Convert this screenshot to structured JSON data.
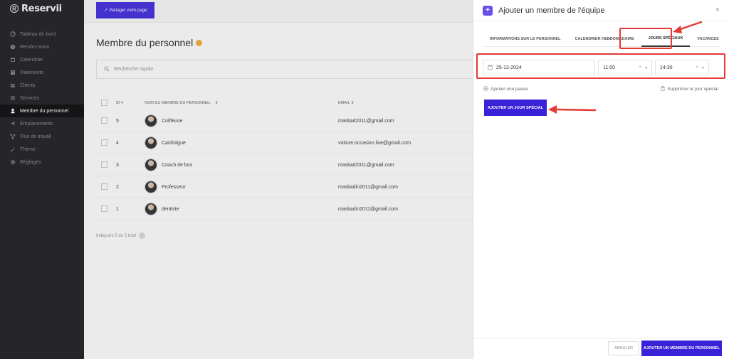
{
  "brand": {
    "name": "Reservii",
    "logo_letter": "R"
  },
  "sidebar": {
    "items": [
      {
        "label": "Tableau de bord",
        "icon": "dashboard-icon"
      },
      {
        "label": "Rendez-vous",
        "icon": "clock-icon"
      },
      {
        "label": "Calendrier",
        "icon": "calendar-icon"
      },
      {
        "label": "Paiements",
        "icon": "payment-icon"
      },
      {
        "label": "Clients",
        "icon": "users-icon"
      },
      {
        "label": "Services",
        "icon": "list-icon"
      },
      {
        "label": "Membre du personnel",
        "icon": "person-icon",
        "active": true
      },
      {
        "label": "Emplacements",
        "icon": "location-icon"
      },
      {
        "label": "Flux de travail",
        "icon": "workflow-icon"
      },
      {
        "label": "Thème",
        "icon": "brush-icon"
      },
      {
        "label": "Réglages",
        "icon": "gear-icon"
      }
    ]
  },
  "topbar": {
    "share_label": "Partager votre page"
  },
  "page": {
    "title": "Membre du personnel",
    "search_placeholder": "Recherche rapide",
    "columns": {
      "id": "ID",
      "name": "NOM DU MEMBRE DU PERSONNEL",
      "email": "EMAIL"
    },
    "rows": [
      {
        "id": "5",
        "name": "Coiffeuse",
        "email": "maskad2011@gmail.com"
      },
      {
        "id": "4",
        "name": "Cardiolgue",
        "email": "voiture.occasion.live@gmail.com"
      },
      {
        "id": "3",
        "name": "Coach de box",
        "email": "maskad2011@gmail.com"
      },
      {
        "id": "2",
        "name": "Professeur",
        "email": "maskadin2011@gmail.com"
      },
      {
        "id": "1",
        "name": "dentiste",
        "email": "maskadin2011@gmail.com"
      }
    ],
    "footer_text": "Indiquant 5 du 5 total",
    "page_number": "1"
  },
  "drawer": {
    "title": "Ajouter un membre de l'équipe",
    "close_symbol": "×",
    "tabs": [
      {
        "label": "INFORMATIONS SUR LE PERSONNEL"
      },
      {
        "label": "CALENDRIER HEBDOMADAIRE"
      },
      {
        "label": "JOURS SPÉCIAUX",
        "active": true
      },
      {
        "label": "VACANCES"
      }
    ],
    "special_day": {
      "date": "25-12-2024",
      "start_time": "11:00",
      "end_time": "14:30"
    },
    "add_pause_label": "Ajouter une pause",
    "delete_special_label": "Supprimer le jour spécial",
    "add_special_button": "AJOUTER UN JOUR SPÉCIAL",
    "cancel_label": "ANNULER",
    "submit_label": "AJOUTER UN MEMBRE DU PERSONNEL"
  },
  "colors": {
    "accent": "#3a22d8",
    "annotation": "#e53935",
    "sidebar_bg": "#2a2a2e"
  }
}
